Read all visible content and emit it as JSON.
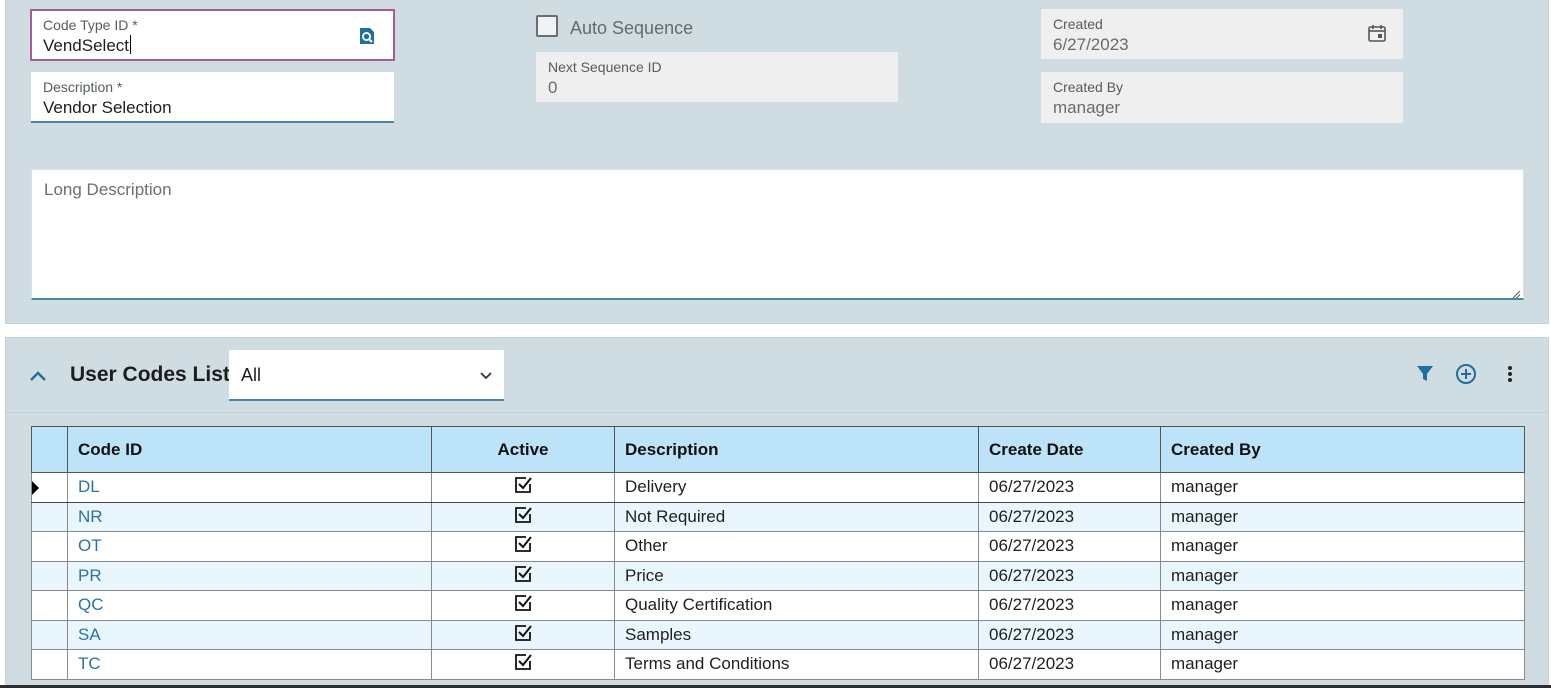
{
  "form": {
    "code_type_id": {
      "label": "Code Type ID *",
      "value": "VendSelect"
    },
    "description": {
      "label": "Description *",
      "value": "Vendor Selection"
    },
    "auto_sequence": {
      "label": "Auto Sequence",
      "checked": false
    },
    "next_sequence_id": {
      "label": "Next Sequence ID",
      "value": "0"
    },
    "created": {
      "label": "Created",
      "value": "6/27/2023"
    },
    "created_by": {
      "label": "Created By",
      "value": "manager"
    },
    "long_description": {
      "label": "Long Description",
      "value": ""
    }
  },
  "list": {
    "title": "User Codes List",
    "filter_value": "All",
    "icons": [
      "chevron-up-icon",
      "filter-icon",
      "add-circle-icon",
      "more-vertical-icon"
    ],
    "columns": {
      "code_id": "Code ID",
      "active": "Active",
      "description": "Description",
      "create_date": "Create Date",
      "created_by": "Created By"
    },
    "rows": [
      {
        "code_id": "DL",
        "active": true,
        "description": "Delivery",
        "create_date": "06/27/2023",
        "created_by": "manager"
      },
      {
        "code_id": "NR",
        "active": true,
        "description": "Not Required",
        "create_date": "06/27/2023",
        "created_by": "manager"
      },
      {
        "code_id": "OT",
        "active": true,
        "description": "Other",
        "create_date": "06/27/2023",
        "created_by": "manager"
      },
      {
        "code_id": "PR",
        "active": true,
        "description": "Price",
        "create_date": "06/27/2023",
        "created_by": "manager"
      },
      {
        "code_id": "QC",
        "active": true,
        "description": "Quality Certification",
        "create_date": "06/27/2023",
        "created_by": "manager"
      },
      {
        "code_id": "SA",
        "active": true,
        "description": "Samples",
        "create_date": "06/27/2023",
        "created_by": "manager"
      },
      {
        "code_id": "TC",
        "active": true,
        "description": "Terms and Conditions",
        "create_date": "06/27/2023",
        "created_by": "manager"
      }
    ]
  },
  "colors": {
    "panel_bg": "#cfdde2",
    "accent": "#4a86a8",
    "focus_border": "#a75d93",
    "header_bg": "#bde3f8",
    "link": "#2a73a3"
  }
}
